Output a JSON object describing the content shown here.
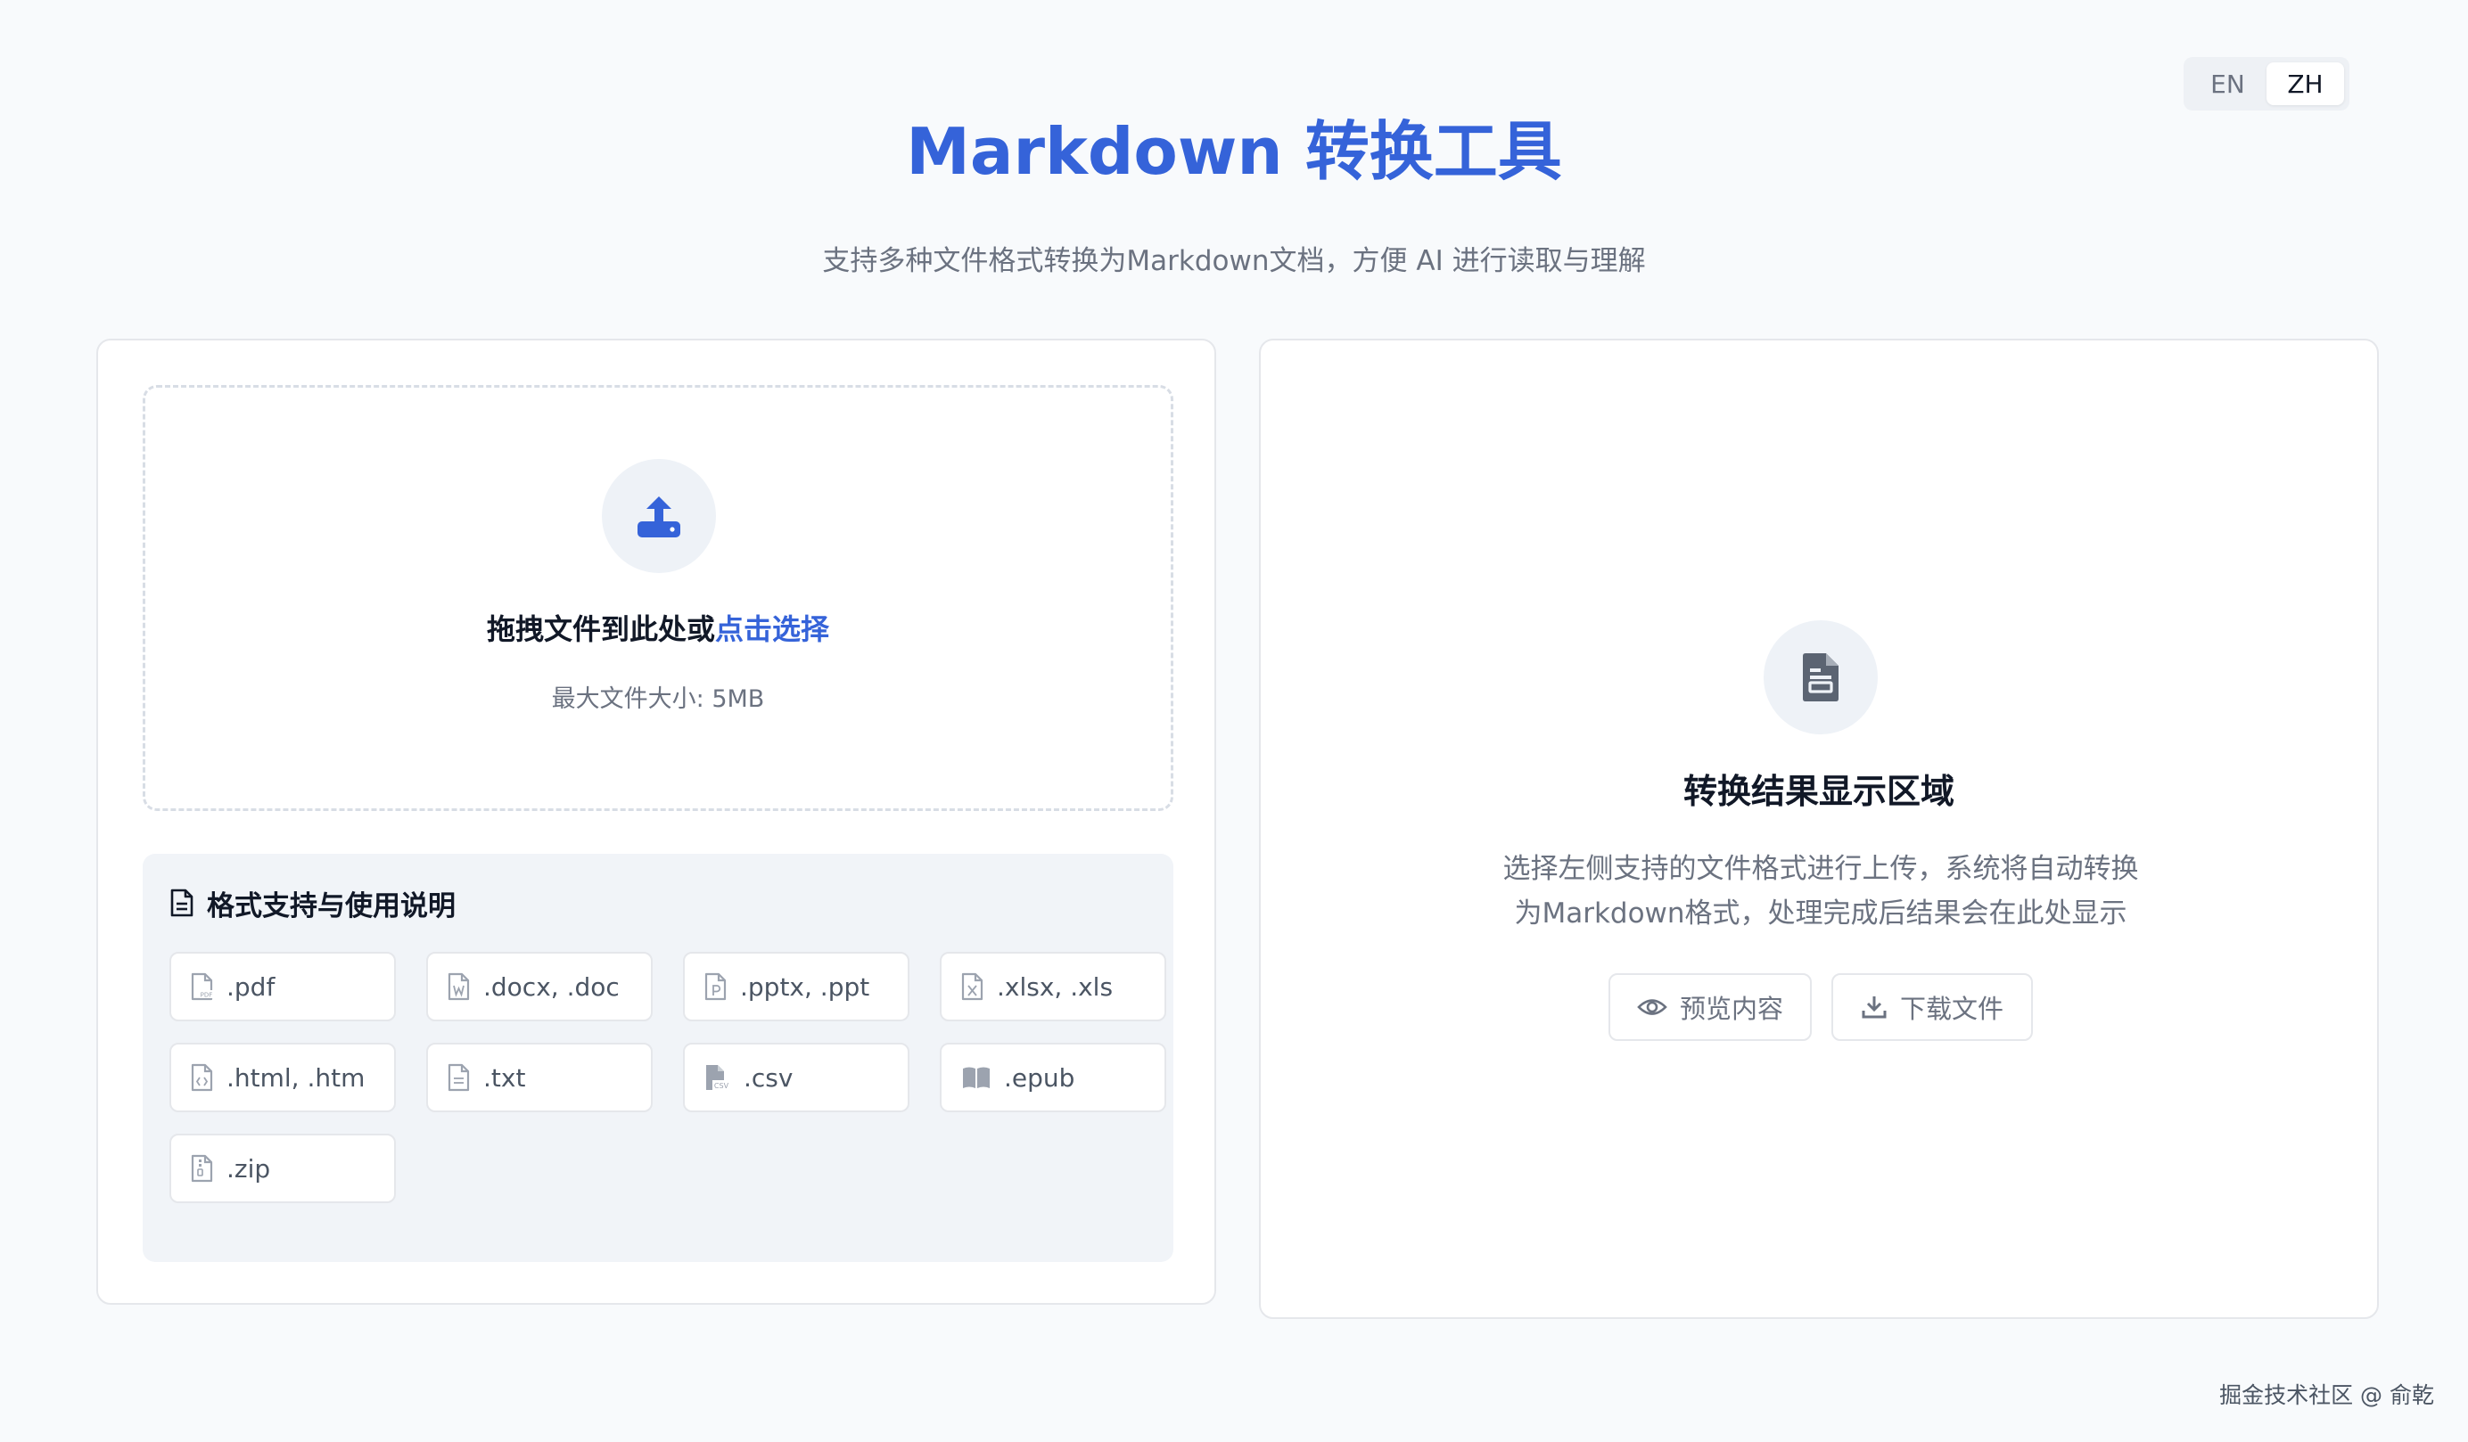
{
  "lang_switch": {
    "options": [
      {
        "label": "EN",
        "active": false
      },
      {
        "label": "ZH",
        "active": true
      }
    ]
  },
  "header": {
    "title": "Markdown 转换工具",
    "subtitle": "支持多种文件格式转换为Markdown文档，方便 AI 进行读取与理解"
  },
  "upload": {
    "prompt": "拖拽文件到此处或",
    "link": "点击选择",
    "max_size": "最大文件大小: 5MB"
  },
  "formats": {
    "heading": "格式支持与使用说明",
    "items": [
      {
        "label": ".pdf",
        "icon": "file-pdf-icon"
      },
      {
        "label": ".docx, .doc",
        "icon": "file-word-icon"
      },
      {
        "label": ".pptx, .ppt",
        "icon": "file-powerpoint-icon"
      },
      {
        "label": ".xlsx, .xls",
        "icon": "file-excel-icon"
      },
      {
        "label": ".html, .htm",
        "icon": "file-code-icon"
      },
      {
        "label": ".txt",
        "icon": "file-text-icon"
      },
      {
        "label": ".csv",
        "icon": "file-csv-icon"
      },
      {
        "label": ".epub",
        "icon": "book-open-icon"
      },
      {
        "label": ".zip",
        "icon": "file-zip-icon"
      }
    ]
  },
  "result": {
    "title": "转换结果显示区域",
    "desc_line1": "选择左侧支持的文件格式进行上传，系统将自动转换",
    "desc_line2": "为Markdown格式，处理完成后结果会在此处显示",
    "preview_label": "预览内容",
    "download_label": "下载文件"
  },
  "watermark": "掘金技术社区 @ 俞乾",
  "colors": {
    "accent": "#3563d9",
    "background": "#f8fafc",
    "muted_text": "#6b7280"
  }
}
